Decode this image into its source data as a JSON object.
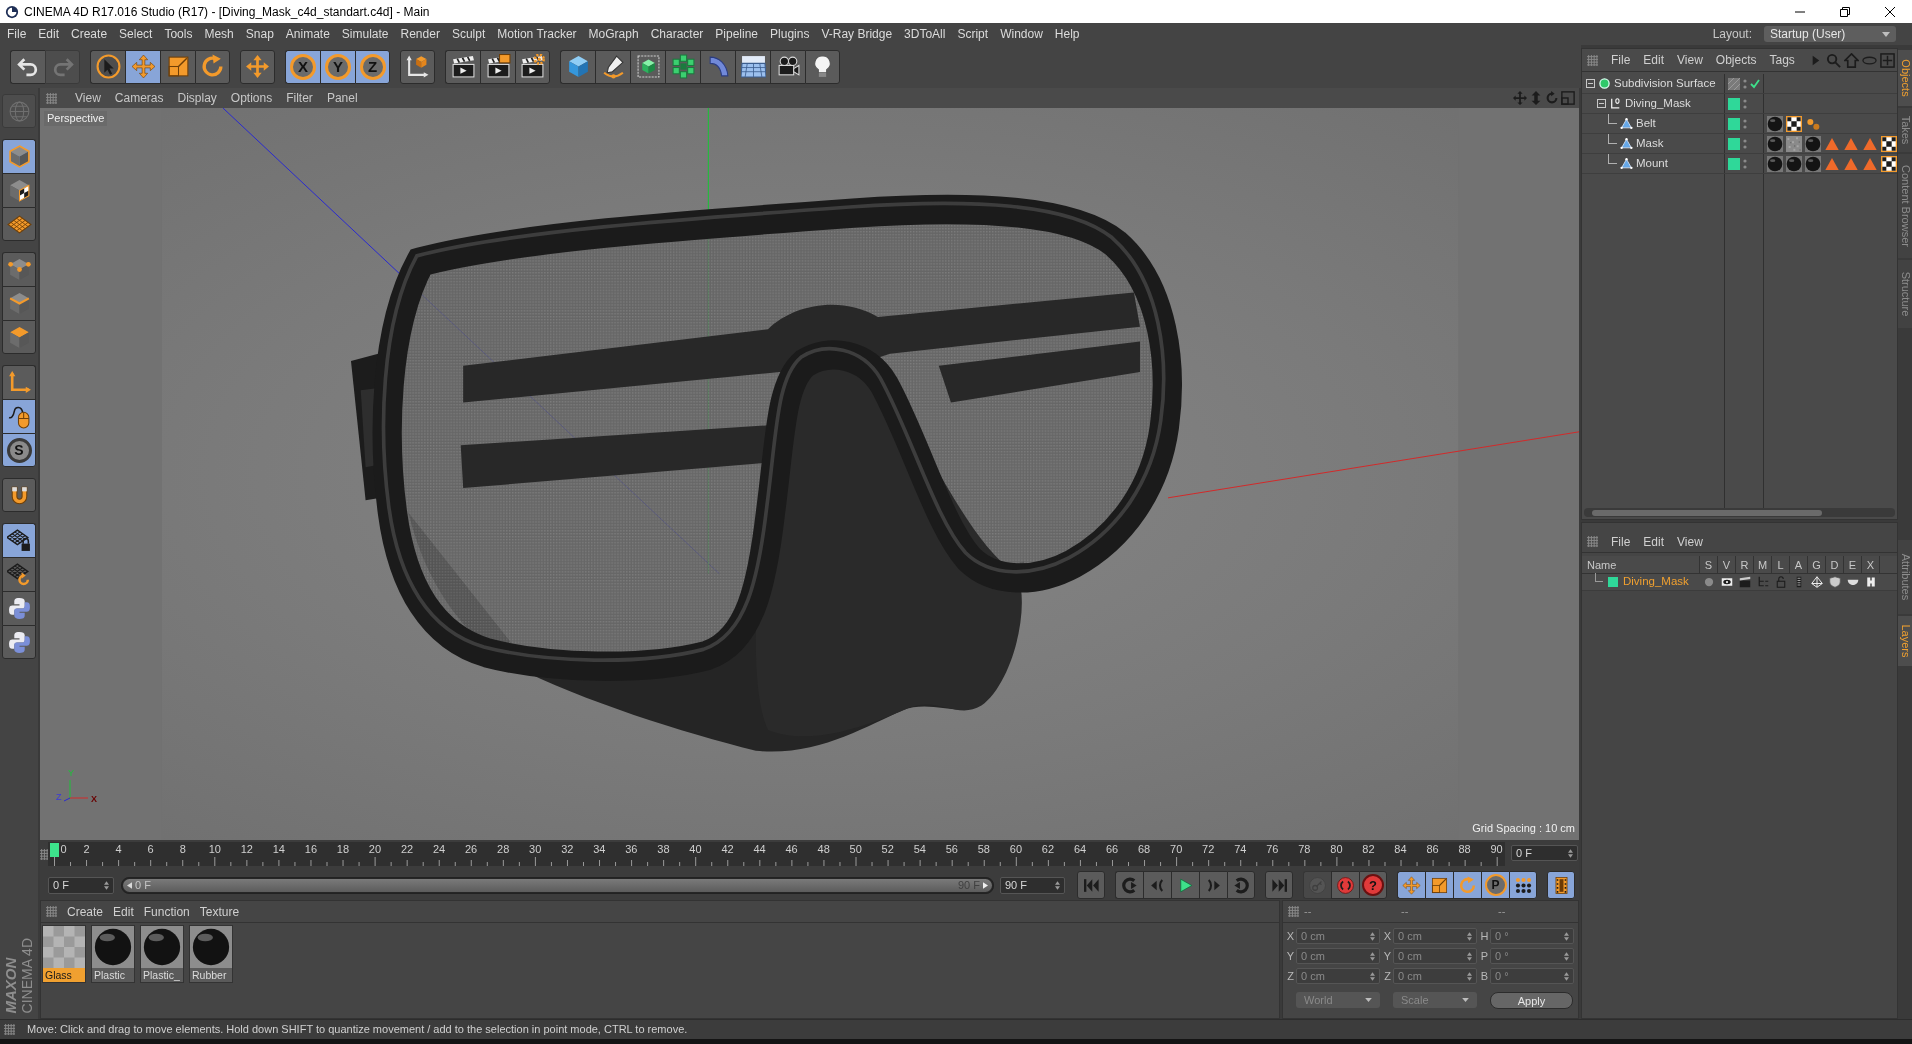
{
  "window": {
    "title": "CINEMA 4D R17.016 Studio (R17) - [Diving_Mask_c4d_standart.c4d] - Main"
  },
  "menu_bar": [
    "File",
    "Edit",
    "Create",
    "Select",
    "Tools",
    "Mesh",
    "Snap",
    "Animate",
    "Simulate",
    "Render",
    "Sculpt",
    "Motion Tracker",
    "MoGraph",
    "Character",
    "Pipeline",
    "Plugins",
    "V-Ray Bridge",
    "3DToAll",
    "Script",
    "Window",
    "Help"
  ],
  "layout": {
    "label": "Layout:",
    "value": "Startup (User)"
  },
  "toolbar": [
    [
      {
        "kind": "undo",
        "active": false,
        "disabled": false
      },
      {
        "kind": "redo",
        "active": false,
        "disabled": true
      }
    ],
    [
      {
        "kind": "select",
        "active": false,
        "disabled": false
      },
      {
        "kind": "move",
        "active": true,
        "disabled": false
      },
      {
        "kind": "scale",
        "active": false,
        "disabled": false
      },
      {
        "kind": "rotate",
        "active": false,
        "disabled": false
      }
    ],
    [
      {
        "kind": "recent-tool",
        "active": false,
        "disabled": false
      }
    ],
    [
      {
        "kind": "axis-lock",
        "label": "X",
        "active": true,
        "disabled": false
      },
      {
        "kind": "axis-lock",
        "label": "Y",
        "active": true,
        "disabled": false
      },
      {
        "kind": "axis-lock",
        "label": "Z",
        "active": true,
        "disabled": false
      }
    ],
    [
      {
        "kind": "coordinate-system",
        "active": false,
        "disabled": false
      }
    ],
    [
      {
        "kind": "render-view",
        "active": false,
        "disabled": false
      },
      {
        "kind": "render-picture",
        "active": false,
        "disabled": false
      },
      {
        "kind": "render-settings",
        "active": false,
        "disabled": false
      }
    ],
    [
      {
        "kind": "cube",
        "active": false,
        "disabled": false
      },
      {
        "kind": "pen",
        "active": false,
        "disabled": false
      },
      {
        "kind": "subdivision",
        "active": false,
        "disabled": false
      },
      {
        "kind": "cloner",
        "active": false,
        "disabled": false
      },
      {
        "kind": "bend",
        "active": false,
        "disabled": false
      },
      {
        "kind": "floor",
        "active": false,
        "disabled": false
      },
      {
        "kind": "camera",
        "active": false,
        "disabled": false
      },
      {
        "kind": "light",
        "active": false,
        "disabled": false
      }
    ]
  ],
  "left_toolbar": [
    [
      {
        "kind": "make-editable",
        "active": false,
        "disabled": true
      }
    ],
    [
      {
        "kind": "model-mode",
        "active": true,
        "disabled": false
      },
      {
        "kind": "texture-mode",
        "active": false,
        "disabled": false
      },
      {
        "kind": "workplane-mode",
        "active": false,
        "disabled": false
      }
    ],
    [
      {
        "kind": "points-mode",
        "active": false,
        "disabled": false
      },
      {
        "kind": "edges-mode",
        "active": false,
        "disabled": false
      },
      {
        "kind": "polygons-mode",
        "active": false,
        "disabled": false
      }
    ],
    [
      {
        "kind": "axis-mode",
        "active": false,
        "disabled": false
      },
      {
        "kind": "tweak-mode",
        "active": true,
        "disabled": false
      },
      {
        "kind": "solo",
        "label": "S",
        "active": true,
        "disabled": false
      }
    ],
    [
      {
        "kind": "snap",
        "active": false,
        "disabled": false
      }
    ],
    [
      {
        "kind": "workplane-lock",
        "active": true,
        "disabled": false
      },
      {
        "kind": "workplane-align",
        "active": false,
        "disabled": false
      },
      {
        "kind": "python",
        "active": false,
        "disabled": false
      },
      {
        "kind": "python",
        "active": false,
        "disabled": false
      }
    ]
  ],
  "viewport": {
    "menu": [
      "View",
      "Cameras",
      "Display",
      "Options",
      "Filter",
      "Panel"
    ],
    "camera": "Perspective",
    "axis_labels": [
      "Y",
      "Z",
      "X"
    ],
    "grid_spacing": "Grid Spacing : 10 cm"
  },
  "object_manager": {
    "menu": [
      "File",
      "Edit",
      "View",
      "Objects",
      "Tags"
    ],
    "objects": [
      {
        "name": "Subdivision Surface",
        "kind": "subdivision",
        "selected": false,
        "expanded": true,
        "enabled": true,
        "children": [
          {
            "name": "Diving_Mask",
            "kind": "null",
            "selected": false,
            "expanded": true,
            "color": "#2fd899",
            "children": [
              {
                "name": "Belt",
                "kind": "polygon",
                "selected": false,
                "color": "#2fd899",
                "tags": [
                  {
                    "kind": "material"
                  },
                  {
                    "kind": "uvw"
                  },
                  {
                    "kind": "point-selection"
                  }
                ]
              },
              {
                "name": "Mask",
                "kind": "polygon",
                "selected": false,
                "color": "#2fd899",
                "tags": [
                  {
                    "kind": "material"
                  },
                  {
                    "kind": "texture-material"
                  },
                  {
                    "kind": "material"
                  },
                  {
                    "kind": "polygon-selection"
                  },
                  {
                    "kind": "polygon-selection"
                  },
                  {
                    "kind": "polygon-selection"
                  },
                  {
                    "kind": "uvw"
                  }
                ]
              },
              {
                "name": "Mount",
                "kind": "polygon",
                "selected": false,
                "color": "#2fd899",
                "tags": [
                  {
                    "kind": "material"
                  },
                  {
                    "kind": "material"
                  },
                  {
                    "kind": "material"
                  },
                  {
                    "kind": "polygon-selection"
                  },
                  {
                    "kind": "polygon-selection"
                  },
                  {
                    "kind": "polygon-selection"
                  },
                  {
                    "kind": "uvw"
                  }
                ]
              }
            ]
          }
        ]
      }
    ],
    "side_tabs": [
      {
        "label": "Objects",
        "selected": true
      },
      {
        "label": "Takes",
        "selected": false
      },
      {
        "label": "Content Browser",
        "selected": false
      },
      {
        "label": "Structure",
        "selected": false
      }
    ]
  },
  "layers": {
    "menu": [
      "File",
      "Edit",
      "View"
    ],
    "columns": [
      "Name",
      "S",
      "V",
      "R",
      "M",
      "L",
      "A",
      "G",
      "D",
      "E",
      "X"
    ],
    "rows": [
      {
        "name": "Diving_Mask",
        "color": "#2fd899",
        "selected": true
      }
    ],
    "side_tabs": [
      {
        "label": "Attributes",
        "selected": false
      },
      {
        "label": "Layers",
        "selected": true
      }
    ]
  },
  "timeline": {
    "ticks": [
      "0",
      "2",
      "4",
      "6",
      "8",
      "10",
      "12",
      "14",
      "16",
      "18",
      "20",
      "22",
      "24",
      "26",
      "28",
      "30",
      "32",
      "34",
      "36",
      "38",
      "40",
      "42",
      "44",
      "46",
      "48",
      "50",
      "52",
      "54",
      "56",
      "58",
      "60",
      "62",
      "64",
      "66",
      "68",
      "70",
      "72",
      "74",
      "76",
      "78",
      "80",
      "82",
      "84",
      "86",
      "88",
      "90"
    ],
    "playhead": {
      "level": 0
    },
    "current_frame": "0 F",
    "start_field": "0 F",
    "range": {
      "start": "0 F",
      "end": "90 F",
      "level": 1
    },
    "end_field": "90 F",
    "transport": [
      [
        {
          "kind": "go-start",
          "active": false,
          "disabled": false
        }
      ],
      [
        {
          "kind": "prev-key",
          "active": false,
          "disabled": false
        },
        {
          "kind": "prev-frame",
          "active": false,
          "disabled": false
        },
        {
          "kind": "play",
          "active": false,
          "disabled": false
        },
        {
          "kind": "next-frame",
          "active": false,
          "disabled": false
        },
        {
          "kind": "next-key",
          "active": false,
          "disabled": false
        }
      ],
      [
        {
          "kind": "go-end",
          "active": false,
          "disabled": false
        }
      ],
      [
        {
          "kind": "record",
          "active": false,
          "disabled": true
        },
        {
          "kind": "autokey",
          "active": false,
          "disabled": false
        },
        {
          "kind": "keyframe-help",
          "label": "?",
          "active": false,
          "disabled": false
        }
      ],
      [
        {
          "kind": "key-position",
          "active": true,
          "disabled": false
        },
        {
          "kind": "key-scale",
          "active": true,
          "disabled": false
        },
        {
          "kind": "key-rotation",
          "active": true,
          "disabled": false
        },
        {
          "kind": "key-param",
          "label": "P",
          "active": true,
          "disabled": false
        },
        {
          "kind": "key-pla",
          "active": true,
          "disabled": false
        }
      ],
      [
        {
          "kind": "timeline-window",
          "active": true,
          "disabled": false
        }
      ]
    ]
  },
  "materials": {
    "menu": [
      "Create",
      "Edit",
      "Function",
      "Texture"
    ],
    "items": [
      {
        "name": "Glass",
        "kind": "glass",
        "selected": true
      },
      {
        "name": "Plastic",
        "kind": "glossy",
        "selected": false
      },
      {
        "name": "Plastic_",
        "kind": "glossy",
        "selected": false
      },
      {
        "name": "Rubber",
        "kind": "glossy",
        "selected": false
      }
    ]
  },
  "coordinates": {
    "headers": [
      "--",
      "--",
      "--"
    ],
    "rows": [
      [
        {
          "axis": "X",
          "value": "0 cm"
        },
        {
          "axis": "X",
          "value": "0 cm"
        },
        {
          "axis": "H",
          "value": "0 °"
        }
      ],
      [
        {
          "axis": "Y",
          "value": "0 cm"
        },
        {
          "axis": "Y",
          "value": "0 cm"
        },
        {
          "axis": "P",
          "value": "0 °"
        }
      ],
      [
        {
          "axis": "Z",
          "value": "0 cm"
        },
        {
          "axis": "Z",
          "value": "0 cm"
        },
        {
          "axis": "B",
          "value": "0 °"
        }
      ]
    ],
    "mode": "World",
    "transform": "Scale",
    "apply": "Apply"
  },
  "logo": {
    "brand": "MAXON",
    "product": "CINEMA 4D"
  },
  "status_bar": "Move: Click and drag to move elements. Hold down SHIFT to quantize movement / add to the selection in point mode, CTRL to remove."
}
